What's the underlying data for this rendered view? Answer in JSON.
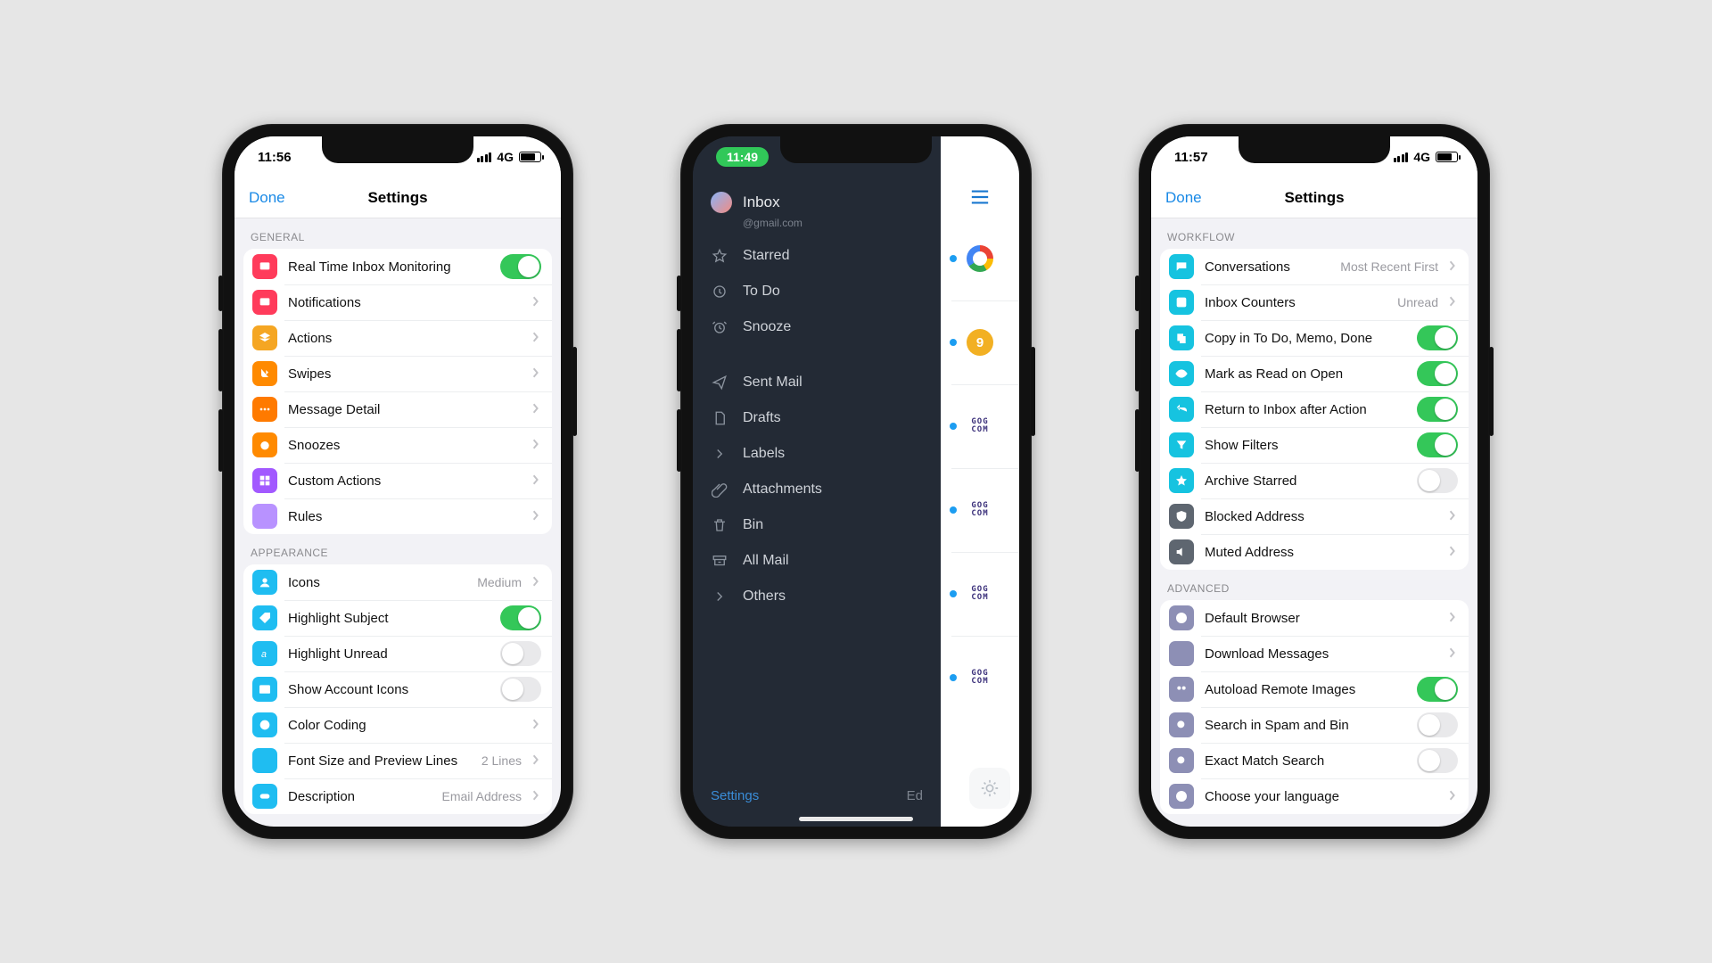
{
  "status": {
    "time_left": "11:56",
    "time_mid": "11:49",
    "time_right": "11:57",
    "net": "4G"
  },
  "settings_header": {
    "done": "Done",
    "title": "Settings"
  },
  "phone1": {
    "s1": {
      "title": "GENERAL"
    },
    "s2": {
      "title": "APPEARANCE"
    },
    "rows": {
      "rt": {
        "label": "Real Time Inbox Monitoring",
        "on": true
      },
      "notif": {
        "label": "Notifications"
      },
      "actions": {
        "label": "Actions"
      },
      "swipes": {
        "label": "Swipes"
      },
      "msgdetail": {
        "label": "Message Detail"
      },
      "snoozes": {
        "label": "Snoozes"
      },
      "custom": {
        "label": "Custom Actions"
      },
      "rules": {
        "label": "Rules"
      },
      "icons": {
        "label": "Icons",
        "value": "Medium"
      },
      "hlsubj": {
        "label": "Highlight Subject",
        "on": true
      },
      "hlunread": {
        "label": "Highlight Unread",
        "on": false
      },
      "acct": {
        "label": "Show Account Icons",
        "on": false
      },
      "color": {
        "label": "Color Coding"
      },
      "font": {
        "label": "Font Size and Preview Lines",
        "value": "2 Lines"
      },
      "desc": {
        "label": "Description",
        "value": "Email Address"
      }
    }
  },
  "sidebar": {
    "account_title": "Inbox",
    "account_sub": "@gmail.com",
    "items1": {
      "starred": "Starred",
      "todo": "To Do",
      "snooze": "Snooze"
    },
    "items2": {
      "sent": "Sent Mail",
      "drafts": "Drafts",
      "labels": "Labels",
      "attach": "Attachments",
      "bin": "Bin",
      "all": "All Mail",
      "others": "Others"
    },
    "bottom_settings": "Settings",
    "bottom_edit": "Ed",
    "peek_badge": "9"
  },
  "phone3": {
    "s1": {
      "title": "WORKFLOW"
    },
    "s2": {
      "title": "ADVANCED"
    },
    "rows": {
      "conv": {
        "label": "Conversations",
        "value": "Most Recent First"
      },
      "count": {
        "label": "Inbox Counters",
        "value": "Unread"
      },
      "copy": {
        "label": "Copy in To Do, Memo, Done",
        "on": true
      },
      "mark": {
        "label": "Mark as Read on Open",
        "on": true
      },
      "return": {
        "label": "Return to Inbox after Action",
        "on": true
      },
      "filters": {
        "label": "Show Filters",
        "on": true
      },
      "archstar": {
        "label": "Archive Starred",
        "on": false
      },
      "blocked": {
        "label": "Blocked Address"
      },
      "muted": {
        "label": "Muted Address"
      },
      "browser": {
        "label": "Default Browser"
      },
      "download": {
        "label": "Download Messages"
      },
      "autoload": {
        "label": "Autoload Remote Images",
        "on": true
      },
      "spam": {
        "label": "Search in Spam and Bin",
        "on": false
      },
      "exact": {
        "label": "Exact Match Search",
        "on": false
      },
      "lang": {
        "label": "Choose your language"
      }
    }
  },
  "colors": {
    "red": "#ff3b5b",
    "yellow": "#f5a623",
    "orange": "#ff8a00",
    "orange2": "#ff7a00",
    "purple": "#a259ff",
    "lav": "#b892ff",
    "cyan": "#1fbdf1",
    "blue": "#1989e6",
    "teal": "#16c3e0",
    "navy": "#5062a8",
    "grey": "#5e6670",
    "slate": "#8d8fb5"
  }
}
